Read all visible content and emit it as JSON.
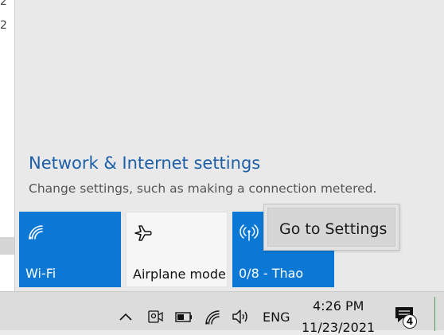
{
  "background_window": {
    "fragments": [
      "2",
      "2"
    ]
  },
  "flyout": {
    "settings_link": "Network & Internet settings",
    "settings_description": "Change settings, such as making a connection metered.",
    "tiles": [
      {
        "label": "Wi-Fi",
        "icon": "wifi-icon",
        "state": "on"
      },
      {
        "label": "Airplane mode",
        "icon": "airplane-icon",
        "state": "off"
      },
      {
        "label": "0/8 - Thao",
        "icon": "mobile-hotspot-icon",
        "state": "on"
      }
    ],
    "tooltip": "Go to Settings"
  },
  "taskbar": {
    "tray_icons": [
      "chevron-up-icon",
      "meet-now-icon",
      "battery-icon",
      "wifi-icon",
      "volume-icon"
    ],
    "language": "ENG",
    "time": "4:26 PM",
    "date": "11/23/2021",
    "notification_count": "4"
  },
  "colors": {
    "accent": "#0a78d4",
    "link": "#1d5fa8",
    "flyout_bg": "#e9e9e9",
    "taskbar_bg": "#dcdcdc"
  }
}
